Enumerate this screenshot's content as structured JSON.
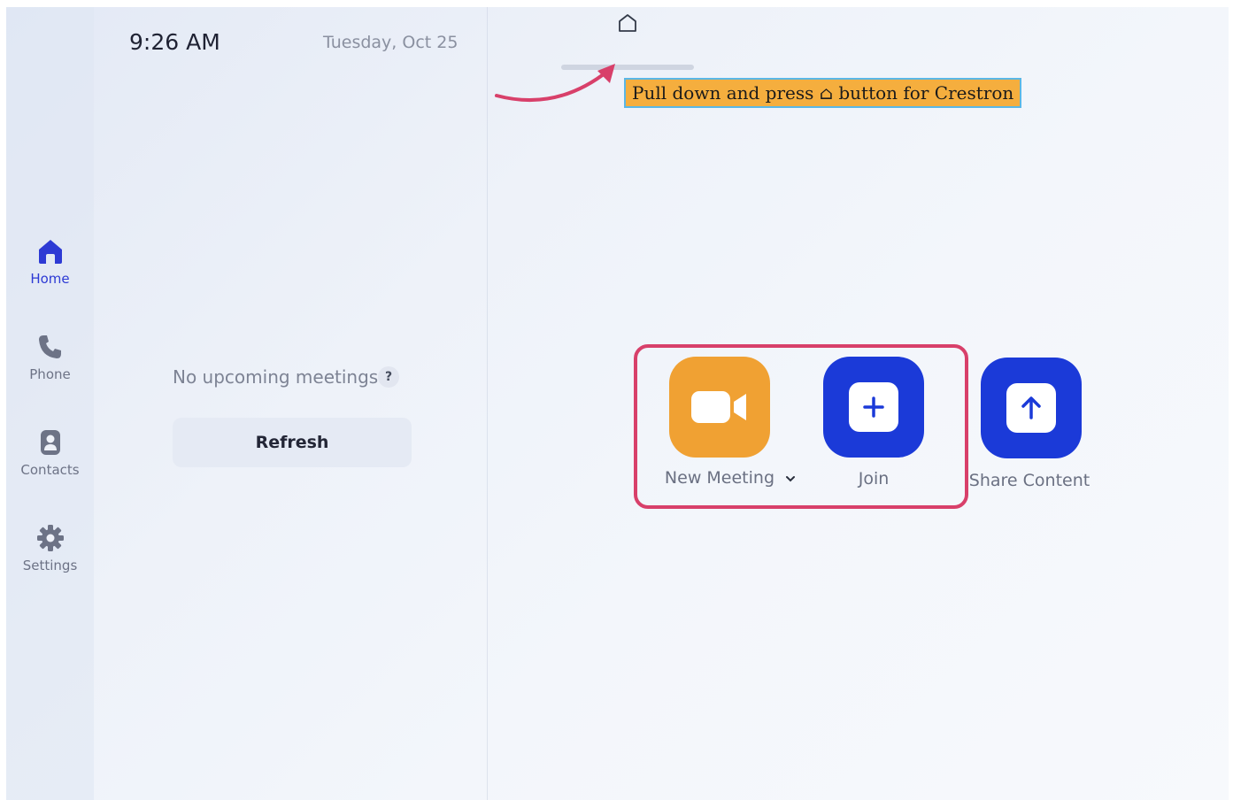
{
  "header": {
    "time": "9:26 AM",
    "date": "Tuesday, Oct 25"
  },
  "sidebar": {
    "items": [
      {
        "label": "Home",
        "icon": "home-icon",
        "active": true
      },
      {
        "label": "Phone",
        "icon": "phone-icon",
        "active": false
      },
      {
        "label": "Contacts",
        "icon": "contacts-icon",
        "active": false
      },
      {
        "label": "Settings",
        "icon": "gear-icon",
        "active": false
      }
    ]
  },
  "meetings": {
    "empty_text": "No upcoming meetings",
    "help_symbol": "?",
    "refresh_label": "Refresh"
  },
  "annotation": {
    "text": "Pull down and press ⌂ button for Crestron",
    "top_icon": "home-outline-icon",
    "arrow_color": "#d8406a",
    "box_color": "#d8406a"
  },
  "actions": [
    {
      "label": "New Meeting",
      "icon": "video-camera-icon",
      "color": "#f0a133",
      "has_dropdown": true
    },
    {
      "label": "Join",
      "icon": "plus-icon",
      "color": "#1b3ad8"
    },
    {
      "label": "Share Content",
      "icon": "upload-arrow-icon",
      "color": "#1b3ad8"
    }
  ],
  "colors": {
    "accent": "#2d3ad4",
    "orange": "#f0a133",
    "annotation_bg": "#f5ae3e",
    "annotation_border": "#5bb7e6"
  }
}
